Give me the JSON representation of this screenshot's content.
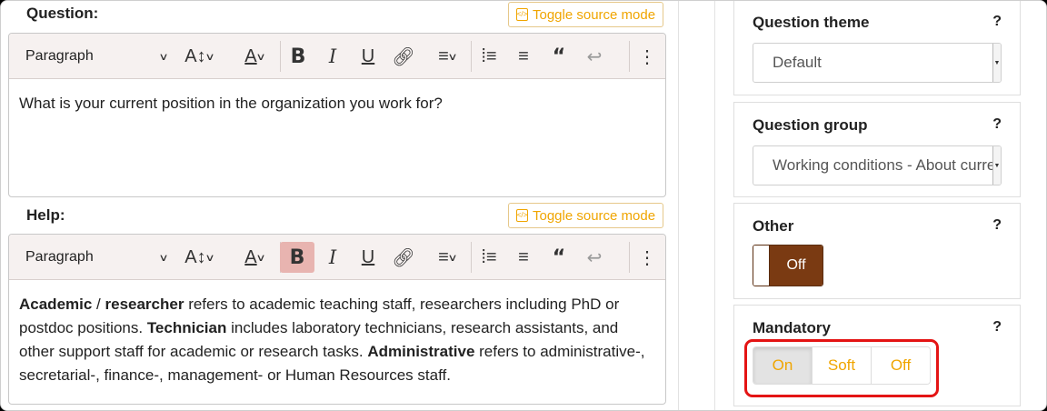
{
  "question": {
    "label": "Question:",
    "toggle_source": "Toggle source mode",
    "toolbar": {
      "paragraph": "Paragraph"
    },
    "content": "What is your current position in the organization you work for?"
  },
  "help": {
    "label": "Help:",
    "toggle_source": "Toggle source mode",
    "toolbar": {
      "paragraph": "Paragraph"
    },
    "content": {
      "b1": "Academic",
      "t1": " / ",
      "b2": "researcher",
      "t2": " refers to academic teaching staff, researchers including PhD or postdoc positions. ",
      "b3": "Technician",
      "t3": " includes laboratory technicians, research assistants, and other support staff for academic or research tasks. ",
      "b4": "Administrative",
      "t4": " refers to administrative-, secretarial-, finance-, management- or Human Resources staff."
    }
  },
  "sidebar": {
    "theme": {
      "title": "Question theme",
      "help": "?",
      "value": "Default"
    },
    "group": {
      "title": "Question group",
      "help": "?",
      "value": "Working conditions - About current position"
    },
    "other": {
      "title": "Other",
      "help": "?",
      "value": "Off"
    },
    "mandatory": {
      "title": "Mandatory",
      "help": "?",
      "options": [
        "On",
        "Soft",
        "Off"
      ],
      "selected": "On"
    }
  },
  "colors": {
    "accent": "#f0a500",
    "switch_off": "#7a3a12",
    "highlight": "#e41414",
    "active_button": "#e8b4b0"
  }
}
